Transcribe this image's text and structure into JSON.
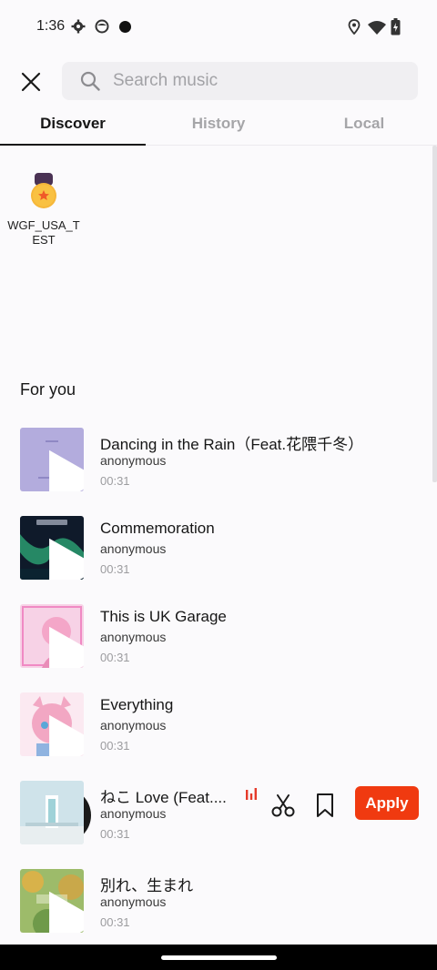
{
  "status_bar": {
    "time": "1:36",
    "icons": [
      "gear-icon",
      "face-icon",
      "dot-icon",
      "location-icon",
      "wifi-icon",
      "battery-icon"
    ]
  },
  "header": {
    "close_icon": "close-icon",
    "search": {
      "placeholder": "Search music",
      "value": "",
      "icon": "search-icon"
    }
  },
  "tabs": [
    {
      "label": "Discover",
      "active": true
    },
    {
      "label": "History",
      "active": false
    },
    {
      "label": "Local",
      "active": false
    }
  ],
  "effects": [
    {
      "label": "WGF_USA_TEST",
      "icon": "medal-icon"
    }
  ],
  "section": {
    "title": "For you"
  },
  "tracks": [
    {
      "title": "Dancing in the Rain（Feat.花隈千冬）",
      "artist": "anonymous",
      "duration": "00:31"
    },
    {
      "title": "Commemoration",
      "artist": "anonymous",
      "duration": "00:31"
    },
    {
      "title": "This is UK Garage",
      "artist": "anonymous",
      "duration": "00:31"
    },
    {
      "title": "Everything",
      "artist": "anonymous",
      "duration": "00:31"
    },
    {
      "title": "ねこ Love (Feat....",
      "artist": "anonymous",
      "duration": "00:31",
      "selected": true,
      "apply_label": "Apply"
    },
    {
      "title": "別れ、生まれ",
      "artist": "anonymous",
      "duration": "00:31"
    }
  ],
  "colors": {
    "accent": "#f03a10",
    "eq_bars": "#e53a2a",
    "text_primary": "#161616",
    "text_muted": "#9c9c9f"
  }
}
